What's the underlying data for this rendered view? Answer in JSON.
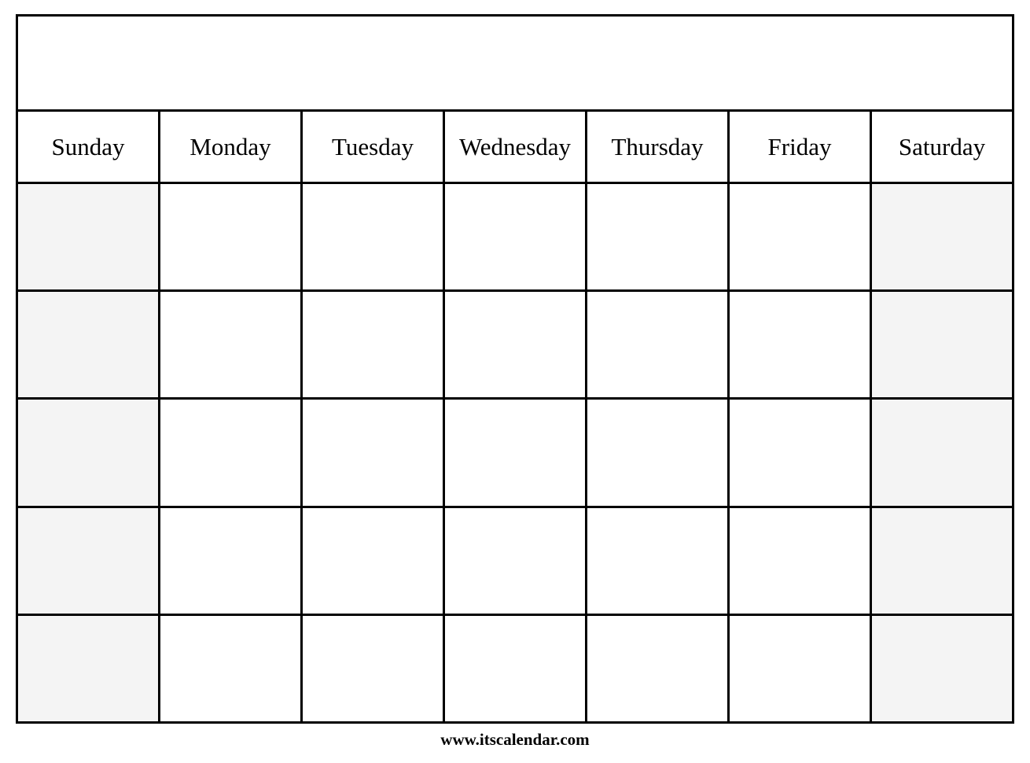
{
  "page": {
    "background_color": "#ffffff",
    "border_color": "#000000",
    "weekend_shade_color": "#f4f4f4"
  },
  "calendar": {
    "title": "",
    "weekday_headers": [
      "Sunday",
      "Monday",
      "Tuesday",
      "Wednesday",
      "Thursday",
      "Friday",
      "Saturday"
    ],
    "weekend_columns": [
      0,
      6
    ],
    "weeks": [
      {
        "days": [
          "",
          "",
          "",
          "",
          "",
          "",
          ""
        ]
      },
      {
        "days": [
          "",
          "",
          "",
          "",
          "",
          "",
          ""
        ]
      },
      {
        "days": [
          "",
          "",
          "",
          "",
          "",
          "",
          ""
        ]
      },
      {
        "days": [
          "",
          "",
          "",
          "",
          "",
          "",
          ""
        ]
      },
      {
        "days": [
          "",
          "",
          "",
          "",
          "",
          "",
          ""
        ]
      }
    ]
  },
  "footer": {
    "credit": "www.itscalendar.com"
  }
}
